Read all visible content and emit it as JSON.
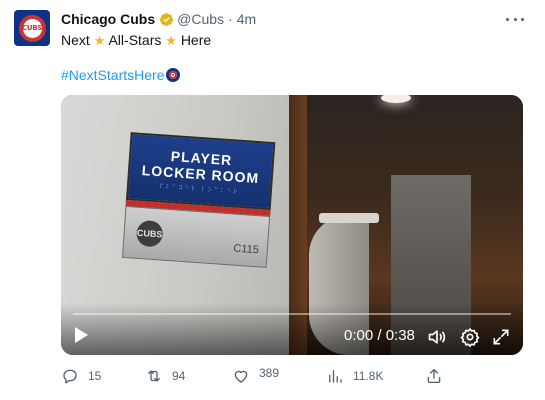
{
  "author": {
    "name": "Chicago Cubs",
    "handle": "@Cubs",
    "separator": "·",
    "time": "4m",
    "avatar_text": "CUBS"
  },
  "tweet": {
    "line1_a": "Next",
    "line1_b": "All-Stars",
    "line1_c": "Here",
    "hashtag": "#NextStartsHere",
    "star_icon": "star-emoji"
  },
  "media": {
    "sign_line1": "PLAYER",
    "sign_line2": "LOCKER ROOM",
    "sign_braille": "⠏⠇⠁⠽⠑⠗ ⠇⠕⠉⠅⠑⠗",
    "sign_logo_text": "CUBS",
    "sign_room_number": "C115",
    "timecode": "0:00 / 0:38",
    "progress": 0
  },
  "actions": {
    "replies": "15",
    "retweets": "94",
    "likes": "389",
    "views": "11.8K"
  },
  "colors": {
    "accent": "#1d9bf0",
    "cubs_blue": "#0e3386",
    "cubs_red": "#cc3433",
    "verified_gold": "#e2b719",
    "secondary_text": "#536471"
  }
}
